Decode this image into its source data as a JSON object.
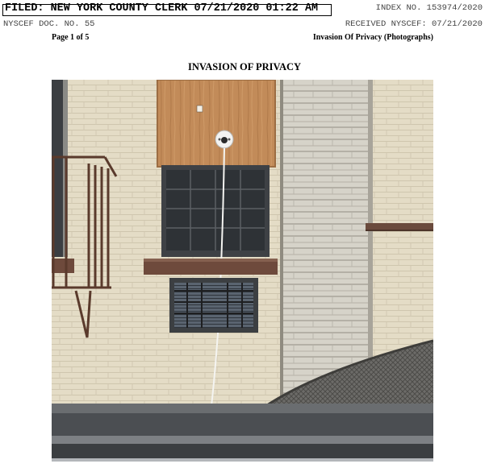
{
  "header": {
    "filed_stamp": "FILED: NEW YORK COUNTY CLERK 07/21/2020 01:22 AM",
    "index_no": "INDEX NO. 153974/2020",
    "doc_no": "NYSCEF DOC. NO. 55",
    "received": "RECEIVED NYSCEF: 07/21/2020"
  },
  "page": {
    "page_label": "Page 1 of 5",
    "title": "Invasion Of Privacy (Photographs)"
  },
  "heading": "INVASION OF PRIVACY",
  "photo": {
    "subject": "Exterior brick wall with boarded window, security camera, lower window with grille, fire escape railing"
  },
  "colors": {
    "brick_wall": "#e4dcc6",
    "plywood": "#c08a58",
    "window_frame": "#4a4c50",
    "sill": "#6e4a3c",
    "pillar": "#d5d1c6"
  }
}
